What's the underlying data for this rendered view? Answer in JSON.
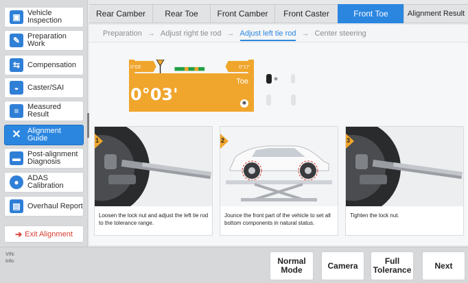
{
  "sidebar": {
    "items": [
      {
        "label": "Vehicle Inspection",
        "icon": "car-icon"
      },
      {
        "label": "Preparation Work",
        "icon": "wrench-icon"
      },
      {
        "label": "Compensation",
        "icon": "compensation-icon"
      },
      {
        "label": "Caster/SAI",
        "icon": "gauge-icon"
      },
      {
        "label": "Measured Result",
        "icon": "list-icon"
      },
      {
        "label": "Alignment Guide",
        "icon": "tools-icon"
      },
      {
        "label": "Post-alignment Diagnosis",
        "icon": "car-icon"
      },
      {
        "label": "ADAS Calibration",
        "icon": "adas-icon"
      },
      {
        "label": "Overhaul Report",
        "icon": "report-icon"
      }
    ],
    "exit_label": "Exit Alignment"
  },
  "tabs": [
    {
      "label": "Rear Camber"
    },
    {
      "label": "Rear Toe"
    },
    {
      "label": "Front Camber"
    },
    {
      "label": "Front Caster"
    },
    {
      "label": "Front Toe"
    },
    {
      "label": "Alignment Result"
    }
  ],
  "steps": [
    {
      "label": "Preparation"
    },
    {
      "label": "Adjust right tie rod"
    },
    {
      "label": "Adjust left tie rod"
    },
    {
      "label": "Center steering"
    }
  ],
  "gauge": {
    "min": "0°03'",
    "max": "0°17'",
    "unit": "Toe",
    "value": "0°03'",
    "color": "#f0a52c",
    "tolerance_color": "#22a046"
  },
  "cards": [
    {
      "num": "1",
      "text": "Loosen the lock nut and adjust the left tie rod to the tolerance range."
    },
    {
      "num": "2",
      "text": "Jounce the front part of the vehicle to set all bottom components in natural status."
    },
    {
      "num": "3",
      "text": "Tighten the lock nut."
    }
  ],
  "footer": {
    "vin_label": "VIN:",
    "info_label": "Info:",
    "buttons": {
      "normal_mode": "Normal Mode",
      "camera": "Camera",
      "full_tolerance": "Full Tolerance",
      "next": "Next"
    }
  },
  "colors": {
    "accent": "#2b86e0",
    "warning": "#f0a52c",
    "exit": "#d83a2f"
  }
}
